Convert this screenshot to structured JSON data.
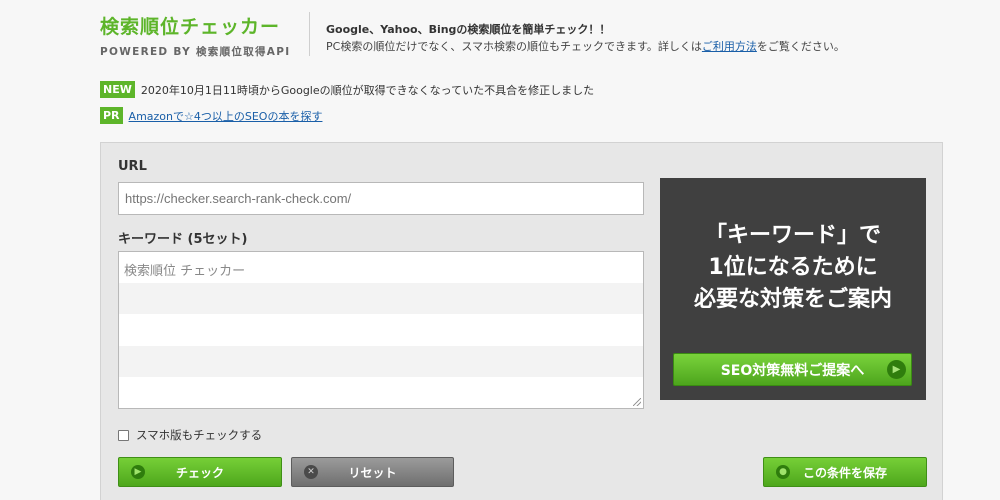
{
  "header": {
    "logo_title": "検索順位チェッカー",
    "logo_sub": "POWERED BY 検索順位取得API",
    "desc_line1": "Google、Yahoo、Bingの検索順位を簡単チェック！！",
    "desc_line2_pre": "PC検索の順位だけでなく、スマホ検索の順位もチェックできます。詳しくは",
    "desc_link": "ご利用方法",
    "desc_line2_post": "をご覧ください。"
  },
  "notices": {
    "new_tag": "NEW",
    "new_text": "2020年10月1日11時頃からGoogleの順位が取得できなくなっていた不具合を修正しました",
    "pr_tag": "PR",
    "pr_link": "Amazonで☆4つ以上のSEOの本を探す"
  },
  "form": {
    "url_label": "URL",
    "url_placeholder": "https://checker.search-rank-check.com/",
    "keyword_label": "キーワード (5セット)",
    "keyword_placeholder": "検索順位 チェッカー",
    "smartphone_label": "スマホ版もチェックする",
    "check_label": "チェック",
    "reset_label": "リセット",
    "save_label": "この条件を保存"
  },
  "promo": {
    "line1": "「キーワード」で",
    "line2": "1位になるために",
    "line3": "必要な対策をご案内",
    "button_label": "SEO対策無料ご提案へ"
  },
  "icons": {
    "check": "arrow-right-circle-icon",
    "reset": "close-circle-icon",
    "save": "save-circle-icon",
    "promo": "chevron-right-circle-icon"
  },
  "colors": {
    "brand_green": "#5db52a",
    "link_blue": "#1a5fa8",
    "promo_bg": "#404040",
    "panel_bg": "#e7e7e7"
  }
}
